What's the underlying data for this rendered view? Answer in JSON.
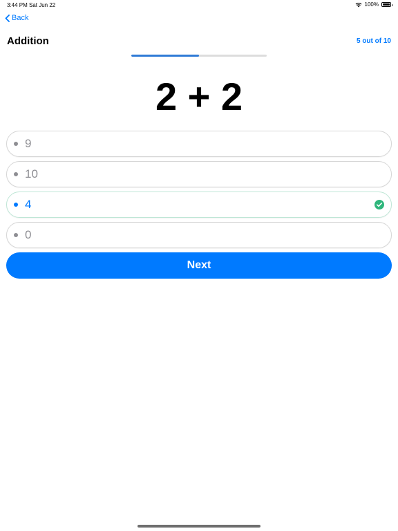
{
  "status_bar": {
    "time": "3:44 PM",
    "date": "Sat Jun 22",
    "battery_text": "100%",
    "battery_level": 1.0
  },
  "nav": {
    "back_label": "Back"
  },
  "quiz": {
    "title": "Addition",
    "progress_label": "5 out of 10",
    "progress_fraction": 0.5,
    "question": "2 + 2",
    "options": [
      {
        "label": "9",
        "state": "default"
      },
      {
        "label": "10",
        "state": "default"
      },
      {
        "label": "4",
        "state": "correct"
      },
      {
        "label": "0",
        "state": "default"
      }
    ],
    "next_label": "Next"
  },
  "colors": {
    "accent": "#007aff",
    "correct": "#2fb67c",
    "muted": "#8e8e93"
  },
  "icons": {
    "back": "chevron-left-icon",
    "correct": "checkmark-circle-icon",
    "wifi": "wifi-icon",
    "battery": "battery-icon"
  }
}
